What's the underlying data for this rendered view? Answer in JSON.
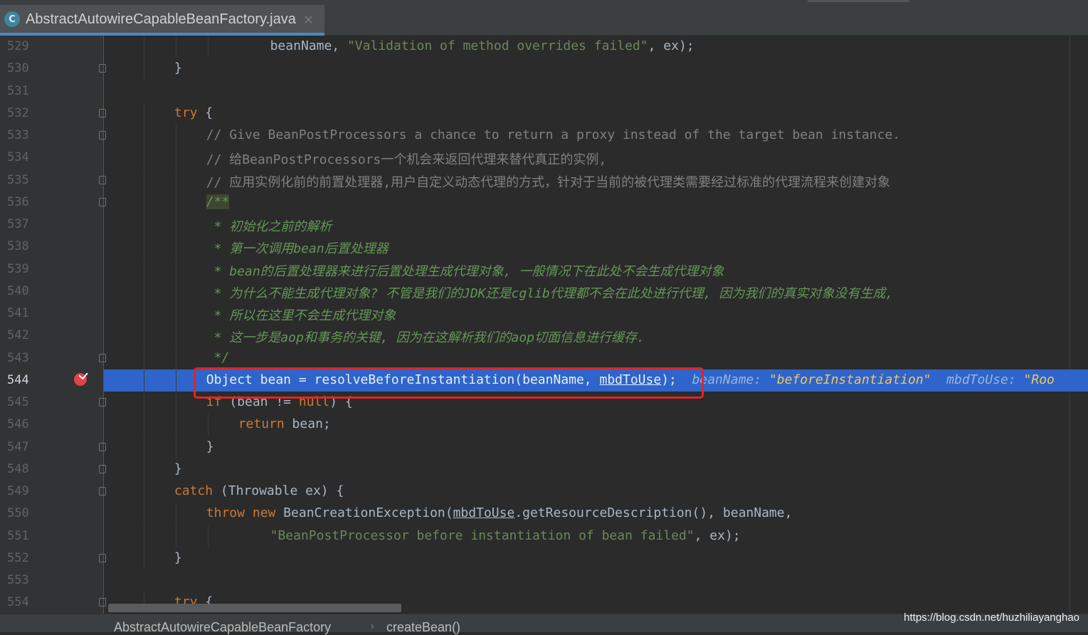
{
  "tab": {
    "icon": "class-file-icon",
    "icon_glyph": "C",
    "filename": "AbstractAutowireCapableBeanFactory.java",
    "close_glyph": "×"
  },
  "lines": [
    {
      "n": "529",
      "indent": 4,
      "fold": false,
      "html": "beanName, <span class='str'>\"Validation of method overrides failed\"</span>, ex);"
    },
    {
      "n": "530",
      "indent": 1,
      "fold": true,
      "html": "}"
    },
    {
      "n": "531",
      "indent": 0,
      "fold": false,
      "html": ""
    },
    {
      "n": "532",
      "indent": 1,
      "fold": true,
      "html": "<span class='kw'>try</span> {"
    },
    {
      "n": "533",
      "indent": 2,
      "fold": true,
      "html": "<span class='cmt'>// Give BeanPostProcessors a chance to return a proxy instead of the target bean instance.</span>"
    },
    {
      "n": "534",
      "indent": 2,
      "fold": false,
      "html": "<span class='cmt'>// 给BeanPostProcessors一个机会来返回代理来替代真正的实例,</span>"
    },
    {
      "n": "535",
      "indent": 2,
      "fold": true,
      "html": "<span class='cmt'>// 应用实例化前的前置处理器,用户自定义动态代理的方式，针对于当前的被代理类需要经过标准的代理流程来创建对象</span>"
    },
    {
      "n": "536",
      "indent": 2,
      "fold": true,
      "html": "<span class='docopen'>/**</span>"
    },
    {
      "n": "537",
      "indent": 2,
      "fold": false,
      "html": "<span class='doc'> * 初始化之前的解析</span>"
    },
    {
      "n": "538",
      "indent": 2,
      "fold": false,
      "html": "<span class='doc'> * 第一次调用bean后置处理器</span>"
    },
    {
      "n": "539",
      "indent": 2,
      "fold": false,
      "html": "<span class='doc'> * bean的后置处理器来进行后置处理生成代理对象, 一般情况下在此处不会生成代理对象</span>"
    },
    {
      "n": "540",
      "indent": 2,
      "fold": false,
      "html": "<span class='doc'> * 为什么不能生成代理对象? 不管是我们的JDK还是cglib代理都不会在此处进行代理, 因为我们的真实对象没有生成,</span>"
    },
    {
      "n": "541",
      "indent": 2,
      "fold": false,
      "html": "<span class='doc'> * 所以在这里不会生成代理对象</span>"
    },
    {
      "n": "542",
      "indent": 2,
      "fold": false,
      "html": "<span class='doc'> * 这一步是aop和事务的关键, 因为在这解析我们的aop切面信息进行缓存.</span>"
    },
    {
      "n": "543",
      "indent": 2,
      "fold": true,
      "html": "<span class='doc'> */</span>"
    },
    {
      "n": "544",
      "indent": 2,
      "fold": false,
      "highlight": true,
      "breakpoint": true,
      "html": "Object bean = resolveBeforeInstantiation(beanName, <span class='uline'>mbdToUse</span>);  <span class='hint'>beanName: </span><span class='hintv'>\"beforeInstantiation\"</span><span class='hint'>  mbdToUse: </span><span class='hintv'>\"Roo</span>"
    },
    {
      "n": "545",
      "indent": 2,
      "fold": true,
      "html": "<span class='kw'>if</span> (bean != <span class='kw'>null</span>) {"
    },
    {
      "n": "546",
      "indent": 3,
      "fold": false,
      "html": "<span class='kw'>return</span> bean;"
    },
    {
      "n": "547",
      "indent": 2,
      "fold": true,
      "html": "}"
    },
    {
      "n": "548",
      "indent": 1,
      "fold": true,
      "html": "}"
    },
    {
      "n": "549",
      "indent": 1,
      "fold": true,
      "html": "<span class='kw'>catch</span> (Throwable ex) {"
    },
    {
      "n": "550",
      "indent": 2,
      "fold": false,
      "html": "<span class='kw'>throw new</span> BeanCreationException(<span class='uline'>mbdToUse</span>.getResourceDescription(), beanName,"
    },
    {
      "n": "551",
      "indent": 4,
      "fold": false,
      "html": "<span class='str'>\"BeanPostProcessor before instantiation of bean failed\"</span>, ex);"
    },
    {
      "n": "552",
      "indent": 1,
      "fold": true,
      "html": "}"
    },
    {
      "n": "553",
      "indent": 0,
      "fold": false,
      "html": ""
    },
    {
      "n": "554",
      "indent": 1,
      "fold": true,
      "html": "<span class='kw'>try</span> {"
    }
  ],
  "breadcrumb": {
    "class_name": "AbstractAutowireCapableBeanFactory",
    "separator": "›",
    "method": "createBean()"
  },
  "watermark": "https://blog.csdn.net/huzhiliayanghao",
  "colors": {
    "background": "#2b2b2b",
    "keyword": "#cc7832",
    "string": "#6a8759",
    "comment": "#808080",
    "doc_comment": "#629755",
    "highlight_line": "#2f65ca",
    "annotation_box": "#e02424"
  }
}
